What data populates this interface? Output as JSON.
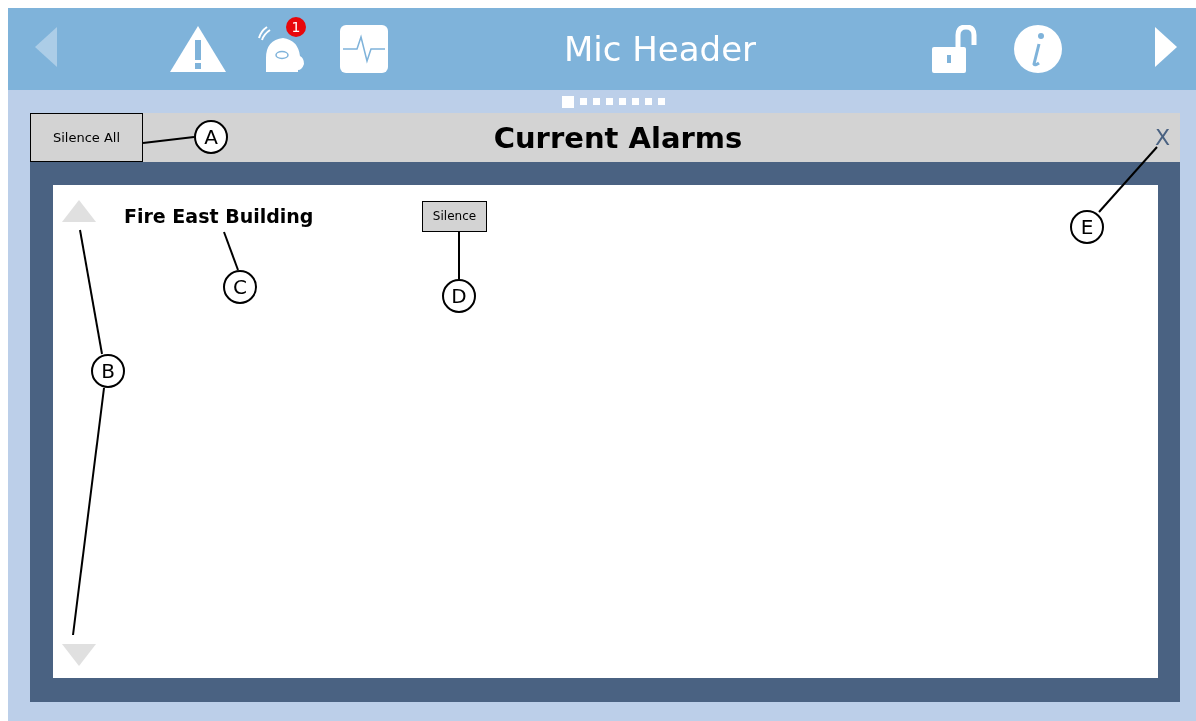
{
  "header": {
    "title": "Mic Header",
    "back": {
      "disabled": true
    },
    "forward": {
      "disabled": false
    },
    "left_icons": [
      {
        "kind": "warning"
      },
      {
        "kind": "bell",
        "badge": "1"
      },
      {
        "kind": "pulse"
      }
    ],
    "right_icons": [
      {
        "kind": "lock"
      },
      {
        "kind": "info"
      }
    ]
  },
  "pager": [
    {
      "selected": true
    },
    {
      "selected": false
    },
    {
      "selected": false
    },
    {
      "selected": false
    },
    {
      "selected": false
    },
    {
      "selected": false
    },
    {
      "selected": false
    },
    {
      "selected": false
    }
  ],
  "panel": {
    "title": "Current Alarms",
    "silence_all": "Silence All",
    "close": "X",
    "scroll_up": {
      "disabled": true
    },
    "scroll_down": {
      "disabled": true
    },
    "alarms": [
      {
        "name": "Fire East Building",
        "button": "Silence"
      }
    ]
  },
  "callouts": [
    {
      "letter": "A"
    },
    {
      "letter": "B"
    },
    {
      "letter": "C"
    },
    {
      "letter": "D"
    },
    {
      "letter": "E"
    }
  ]
}
